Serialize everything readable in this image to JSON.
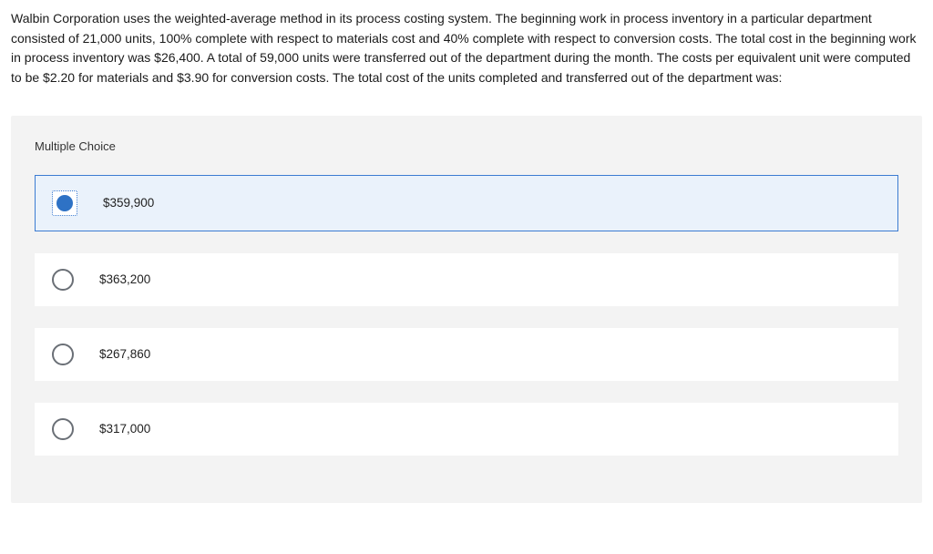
{
  "question": "Walbin Corporation uses the weighted-average method in its process costing system. The beginning work in process inventory in a particular department consisted of 21,000 units, 100% complete with respect to materials cost and 40% complete with respect to conversion costs. The total cost in the beginning work in process inventory was $26,400. A total of 59,000 units were transferred out of the department during the month. The costs per equivalent unit were computed to be $2.20 for materials and $3.90 for conversion costs. The total cost of the units completed and transferred out of the department was:",
  "section_label": "Multiple Choice",
  "options": [
    {
      "label": "$359,900",
      "selected": true
    },
    {
      "label": "$363,200",
      "selected": false
    },
    {
      "label": "$267,860",
      "selected": false
    },
    {
      "label": "$317,000",
      "selected": false
    }
  ],
  "colors": {
    "accent": "#2e72c5",
    "selected_bg": "#eaf2fb",
    "panel_bg": "#f3f3f3"
  }
}
